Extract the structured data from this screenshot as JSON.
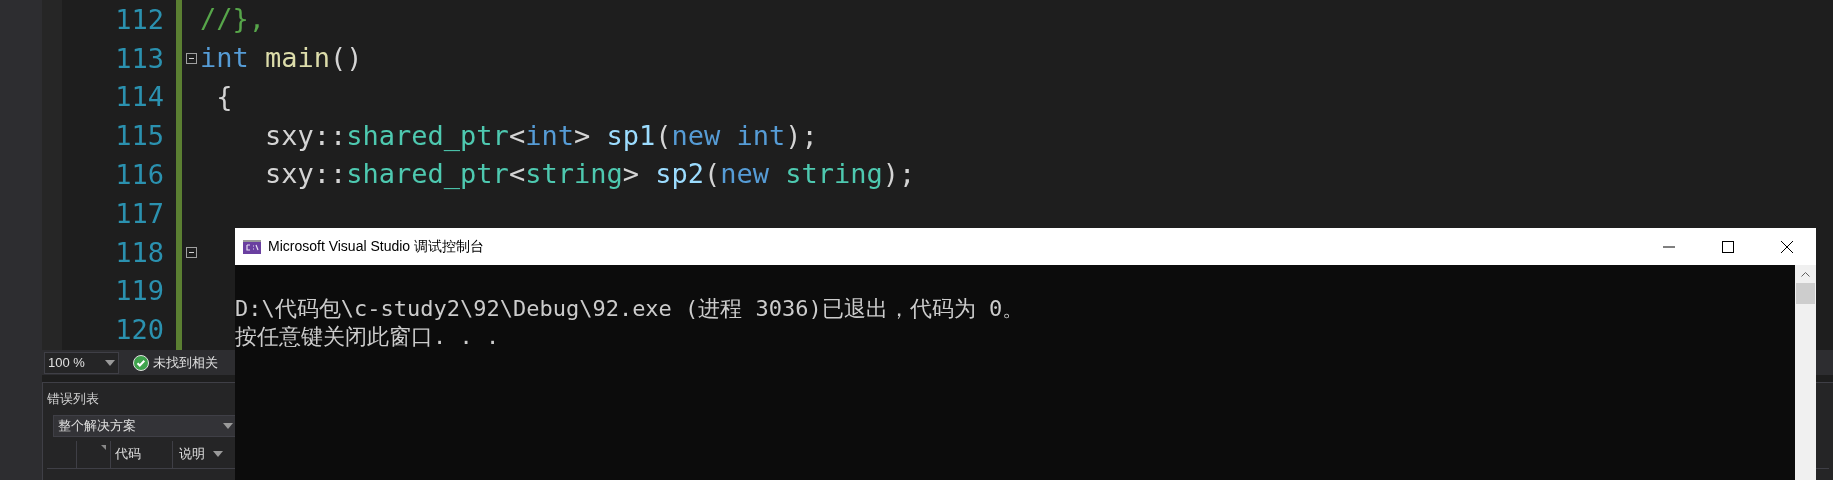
{
  "editor": {
    "lines": [
      {
        "number": "112",
        "fold": false,
        "tokens": [
          {
            "kind": "comment",
            "text": "//},"
          }
        ]
      },
      {
        "number": "113",
        "fold": true,
        "tokens": [
          {
            "kind": "keyword",
            "text": "int"
          },
          {
            "kind": "function",
            "text": " main"
          },
          {
            "kind": "plain",
            "text": "()"
          }
        ]
      },
      {
        "number": "114",
        "fold": false,
        "tokens": [
          {
            "kind": "plain",
            "text": " {"
          }
        ]
      },
      {
        "number": "115",
        "fold": false,
        "tokens": [
          {
            "kind": "plain",
            "text": "    sxy::"
          },
          {
            "kind": "type",
            "text": "shared_ptr"
          },
          {
            "kind": "plain",
            "text": "<"
          },
          {
            "kind": "keyword",
            "text": "int"
          },
          {
            "kind": "plain",
            "text": "> "
          },
          {
            "kind": "variable",
            "text": "sp1"
          },
          {
            "kind": "plain",
            "text": "("
          },
          {
            "kind": "keyword",
            "text": "new"
          },
          {
            "kind": "keyword",
            "text": " int"
          },
          {
            "kind": "plain",
            "text": ");"
          }
        ]
      },
      {
        "number": "116",
        "fold": false,
        "tokens": [
          {
            "kind": "plain",
            "text": "    sxy::"
          },
          {
            "kind": "type",
            "text": "shared_ptr"
          },
          {
            "kind": "plain",
            "text": "<"
          },
          {
            "kind": "type",
            "text": "string"
          },
          {
            "kind": "plain",
            "text": "> "
          },
          {
            "kind": "variable",
            "text": "sp2"
          },
          {
            "kind": "plain",
            "text": "("
          },
          {
            "kind": "keyword",
            "text": "new"
          },
          {
            "kind": "type",
            "text": " string"
          },
          {
            "kind": "plain",
            "text": ");"
          }
        ]
      },
      {
        "number": "117",
        "fold": false
      },
      {
        "number": "118",
        "fold": true
      },
      {
        "number": "119",
        "fold": false
      },
      {
        "number": "120",
        "fold": false
      }
    ]
  },
  "status_bar": {
    "zoom": "100 %",
    "message": "未找到相关"
  },
  "error_list": {
    "title": "错误列表",
    "scope": "整个解决方案",
    "columns": [
      "代码",
      "说明"
    ]
  },
  "console": {
    "title": "Microsoft Visual Studio 调试控制台",
    "lines": [
      "D:\\代码包\\c-study2\\92\\Debug\\92.exe (进程 3036)已退出，代码为 0。",
      "按任意键关闭此窗口. . ."
    ]
  }
}
